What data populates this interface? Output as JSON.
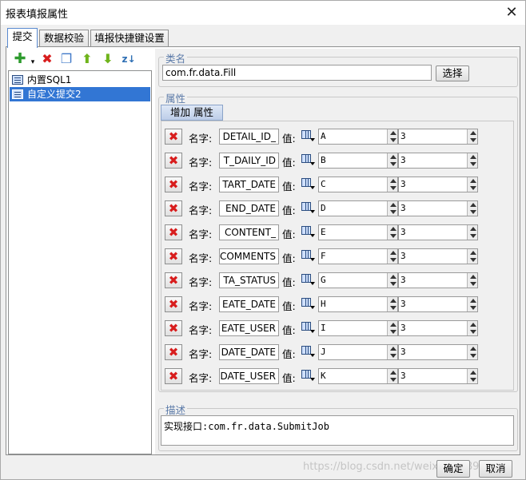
{
  "window": {
    "title": "报表填报属性",
    "close_glyph": "✕"
  },
  "tabs": [
    {
      "label": "提交",
      "active": true
    },
    {
      "label": "数据校验",
      "active": false
    },
    {
      "label": "填报快捷键设置",
      "active": false
    }
  ],
  "toolbar": {
    "icons": [
      "add-icon",
      "delete-icon",
      "copy-icon",
      "move-up-icon",
      "move-down-icon",
      "sort-icon"
    ],
    "colors": {
      "add": "#2e9b2e",
      "delete": "#d81d1d",
      "arrow": "#6fb41b"
    }
  },
  "list": {
    "items": [
      {
        "label": "内置SQL1",
        "selected": false
      },
      {
        "label": "自定义提交2",
        "selected": true
      }
    ]
  },
  "classname": {
    "group_label": "类名",
    "value": "com.fr.data.Fill",
    "choose_label": "选择"
  },
  "properties": {
    "group_label": "属性",
    "add_label": "增加 属性",
    "name_label": "名字:",
    "value_label": "值:",
    "rows": [
      {
        "name": "_DETAIL_ID",
        "value": "A",
        "index": "3"
      },
      {
        "name": "T_DAILY_ID",
        "value": "B",
        "index": "3"
      },
      {
        "name": "TART_DATE",
        "value": "C",
        "index": "3"
      },
      {
        "name": "END_DATE",
        "value": "D",
        "index": "3"
      },
      {
        "name": "_CONTENT",
        "value": "E",
        "index": "3"
      },
      {
        "name": "COMMENTS",
        "value": "F",
        "index": "3"
      },
      {
        "name": "TA_STATUS",
        "value": "G",
        "index": "3"
      },
      {
        "name": "EATE_DATE",
        "value": "H",
        "index": "3"
      },
      {
        "name": "EATE_USER",
        "value": "I",
        "index": "3"
      },
      {
        "name": "DATE_DATE",
        "value": "J",
        "index": "3"
      },
      {
        "name": "DATE_USER",
        "value": "K",
        "index": "3"
      }
    ]
  },
  "description": {
    "group_label": "描述",
    "value": "实现接口:com.fr.data.SubmitJob"
  },
  "footer": {
    "ok_label": "确定",
    "cancel_label": "取消"
  },
  "watermark": "https://blog.csdn.net/weixin_40897319"
}
